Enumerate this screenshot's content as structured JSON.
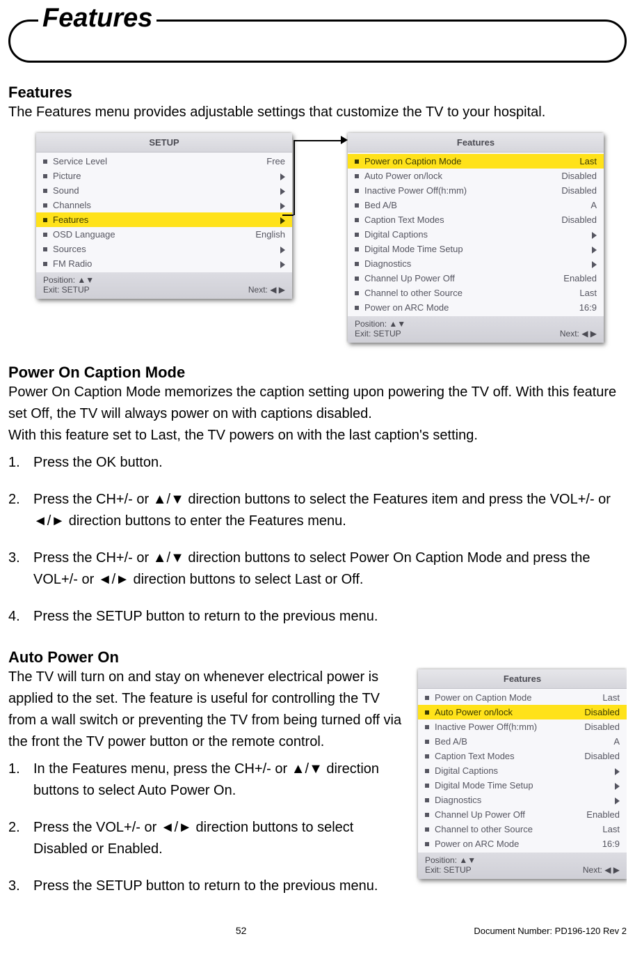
{
  "page": {
    "cartouche_title": "Features",
    "number": "52",
    "doc_number": "Document Number: PD196-120 Rev 2"
  },
  "section_features": {
    "heading": "Features",
    "intro": "The Features menu provides adjustable settings that customize the TV to your hospital."
  },
  "osd_setup": {
    "title": "SETUP",
    "items": [
      {
        "label": "Service Level",
        "value": "Free",
        "hl": false
      },
      {
        "label": "Picture",
        "value": "▶",
        "hl": false
      },
      {
        "label": "Sound",
        "value": "▶",
        "hl": false
      },
      {
        "label": "Channels",
        "value": "▶",
        "hl": false
      },
      {
        "label": "Features",
        "value": "▶",
        "hl": true
      },
      {
        "label": "OSD Language",
        "value": "English",
        "hl": false
      },
      {
        "label": "Sources",
        "value": "▶",
        "hl": false
      },
      {
        "label": "FM Radio",
        "value": "▶",
        "hl": false
      }
    ],
    "footer_pos": "Position: ▲▼",
    "footer_exit": "Exit: SETUP",
    "footer_next": "Next: ◀ ▶"
  },
  "osd_features": {
    "title": "Features",
    "highlight_index": 0,
    "items": [
      {
        "label": "Power on Caption Mode",
        "value": "Last"
      },
      {
        "label": "Auto Power on/lock",
        "value": "Disabled"
      },
      {
        "label": "Inactive Power Off(h:mm)",
        "value": "Disabled"
      },
      {
        "label": "Bed A/B",
        "value": "A"
      },
      {
        "label": "Caption Text Modes",
        "value": "Disabled"
      },
      {
        "label": "Digital Captions",
        "value": "▶"
      },
      {
        "label": "Digital Mode Time Setup",
        "value": "▶"
      },
      {
        "label": "Diagnostics",
        "value": "▶"
      },
      {
        "label": "Channel Up Power Off",
        "value": "Enabled"
      },
      {
        "label": "Channel to other Source",
        "value": "Last"
      },
      {
        "label": "Power on ARC Mode",
        "value": "16:9"
      }
    ],
    "footer_pos": "Position: ▲▼",
    "footer_exit": "Exit: SETUP",
    "footer_next": "Next: ◀ ▶"
  },
  "osd_features2_highlight_index": 1,
  "section_power": {
    "heading": "Power On Caption Mode",
    "p1": "Power On Caption Mode memorizes the caption setting upon powering the TV off. With this feature set Off, the TV will always power on with captions disabled.",
    "p2": "With this feature set to Last, the TV powers on with the last caption's setting.",
    "step1": "Press the OK button.",
    "step2": "Press the CH+/- or ▲/▼ direction buttons to select the Features item and press the VOL+/- or ◄/► direction buttons to enter the Features menu.",
    "step3": "Press the CH+/- or ▲/▼ direction buttons to select Power On Caption Mode and press the VOL+/- or ◄/► direction buttons to select Last or Off.",
    "step4": "Press the SETUP button to return to the previous menu."
  },
  "section_auto": {
    "heading": "Auto Power On",
    "intro": "The TV will turn on and stay on whenever electrical power is applied to the set. The feature is useful for controlling the TV from a wall switch or preventing the TV from being turned off via the front the TV power button or the remote control.",
    "step1": "In the Features menu, press the CH+/- or ▲/▼ direction buttons to select Auto Power On.",
    "step2": "Press the VOL+/- or ◄/► direction buttons to select Disabled or Enabled.",
    "step3": "Press the SETUP button to return to the previous menu."
  },
  "chart_data": {
    "type": "table",
    "tables": [
      {
        "title": "SETUP",
        "highlighted_row": "Features",
        "rows": [
          [
            "Service Level",
            "Free"
          ],
          [
            "Picture",
            "submenu"
          ],
          [
            "Sound",
            "submenu"
          ],
          [
            "Channels",
            "submenu"
          ],
          [
            "Features",
            "submenu"
          ],
          [
            "OSD Language",
            "English"
          ],
          [
            "Sources",
            "submenu"
          ],
          [
            "FM Radio",
            "submenu"
          ]
        ]
      },
      {
        "title": "Features",
        "highlighted_row_variant1": "Power on Caption Mode",
        "highlighted_row_variant2": "Auto Power on/lock",
        "rows": [
          [
            "Power on Caption Mode",
            "Last"
          ],
          [
            "Auto Power on/lock",
            "Disabled"
          ],
          [
            "Inactive Power Off(h:mm)",
            "Disabled"
          ],
          [
            "Bed A/B",
            "A"
          ],
          [
            "Caption Text Modes",
            "Disabled"
          ],
          [
            "Digital Captions",
            "submenu"
          ],
          [
            "Digital Mode Time Setup",
            "submenu"
          ],
          [
            "Diagnostics",
            "submenu"
          ],
          [
            "Channel Up Power Off",
            "Enabled"
          ],
          [
            "Channel to other Source",
            "Last"
          ],
          [
            "Power on ARC Mode",
            "16:9"
          ]
        ]
      }
    ]
  }
}
